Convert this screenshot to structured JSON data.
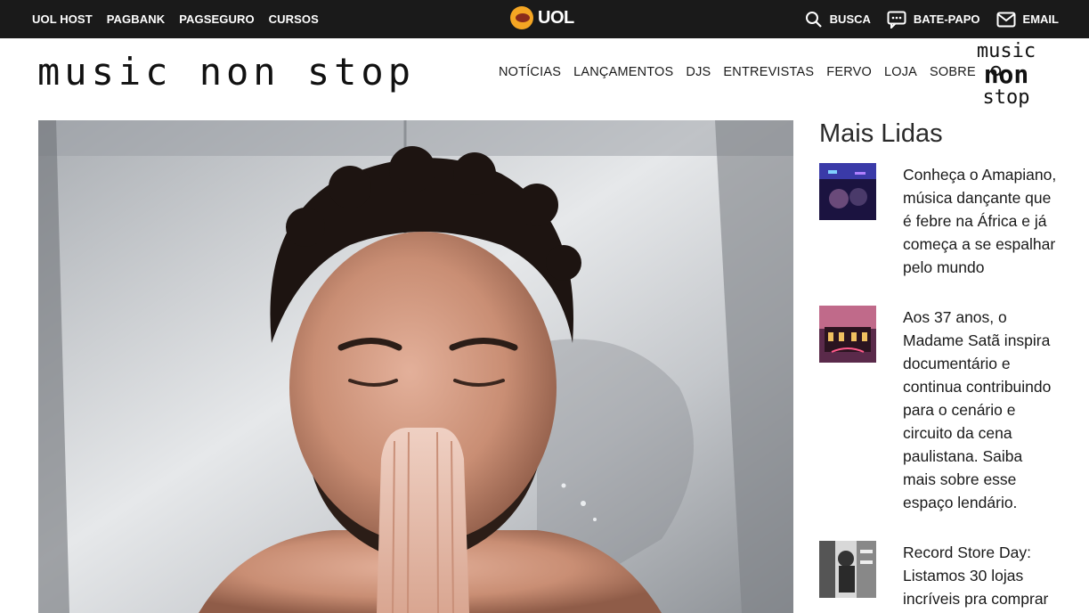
{
  "uol_bar": {
    "links": [
      "UOL HOST",
      "PAGBANK",
      "PAGSEGURO",
      "CURSOS"
    ],
    "logo_text": "UOL",
    "right": [
      {
        "icon": "search-icon",
        "label": "BUSCA"
      },
      {
        "icon": "chat-icon",
        "label": "BATE-PAPO"
      },
      {
        "icon": "mail-icon",
        "label": "EMAIL"
      }
    ]
  },
  "site": {
    "logo_text": "music non stop",
    "nav": [
      "NOTÍCIAS",
      "LANÇAMENTOS",
      "DJS",
      "ENTREVISTAS",
      "FERVO",
      "LOJA",
      "SOBRE"
    ],
    "stacked_logo": [
      "music",
      "non",
      "stop"
    ]
  },
  "sidebar": {
    "title": "Mais Lidas",
    "items": [
      {
        "text": "Conheça o Amapiano, música dançante que é febre na África e já começa a se espalhar pelo mundo"
      },
      {
        "text": "Aos 37 anos, o Madame Satã inspira documentário e continua contribuindo para o cenário e circuito da cena paulistana. Saiba mais sobre esse espaço lendário."
      },
      {
        "text": "Record Store Day: Listamos 30 lojas incríveis pra comprar"
      }
    ]
  },
  "colors": {
    "top_bar": "#1a1a1a",
    "uol_ball": "#f5a623",
    "text": "#1a1a1a"
  }
}
